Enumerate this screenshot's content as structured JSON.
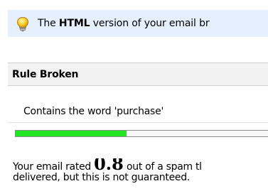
{
  "notice": {
    "icon": "lightbulb-icon",
    "text_before": "The ",
    "text_bold": "HTML",
    "text_after": " version of your email br"
  },
  "rule": {
    "title": "Rule Broken",
    "name": "Contains the word 'purchase'"
  },
  "rating": {
    "progress_fraction": 0.44,
    "bar_color": "#22e622",
    "line1_before": "Your email rated ",
    "score": "0.8",
    "line1_after": " out of a spam tl",
    "line2": "delivered, but this is not guaranteed."
  }
}
